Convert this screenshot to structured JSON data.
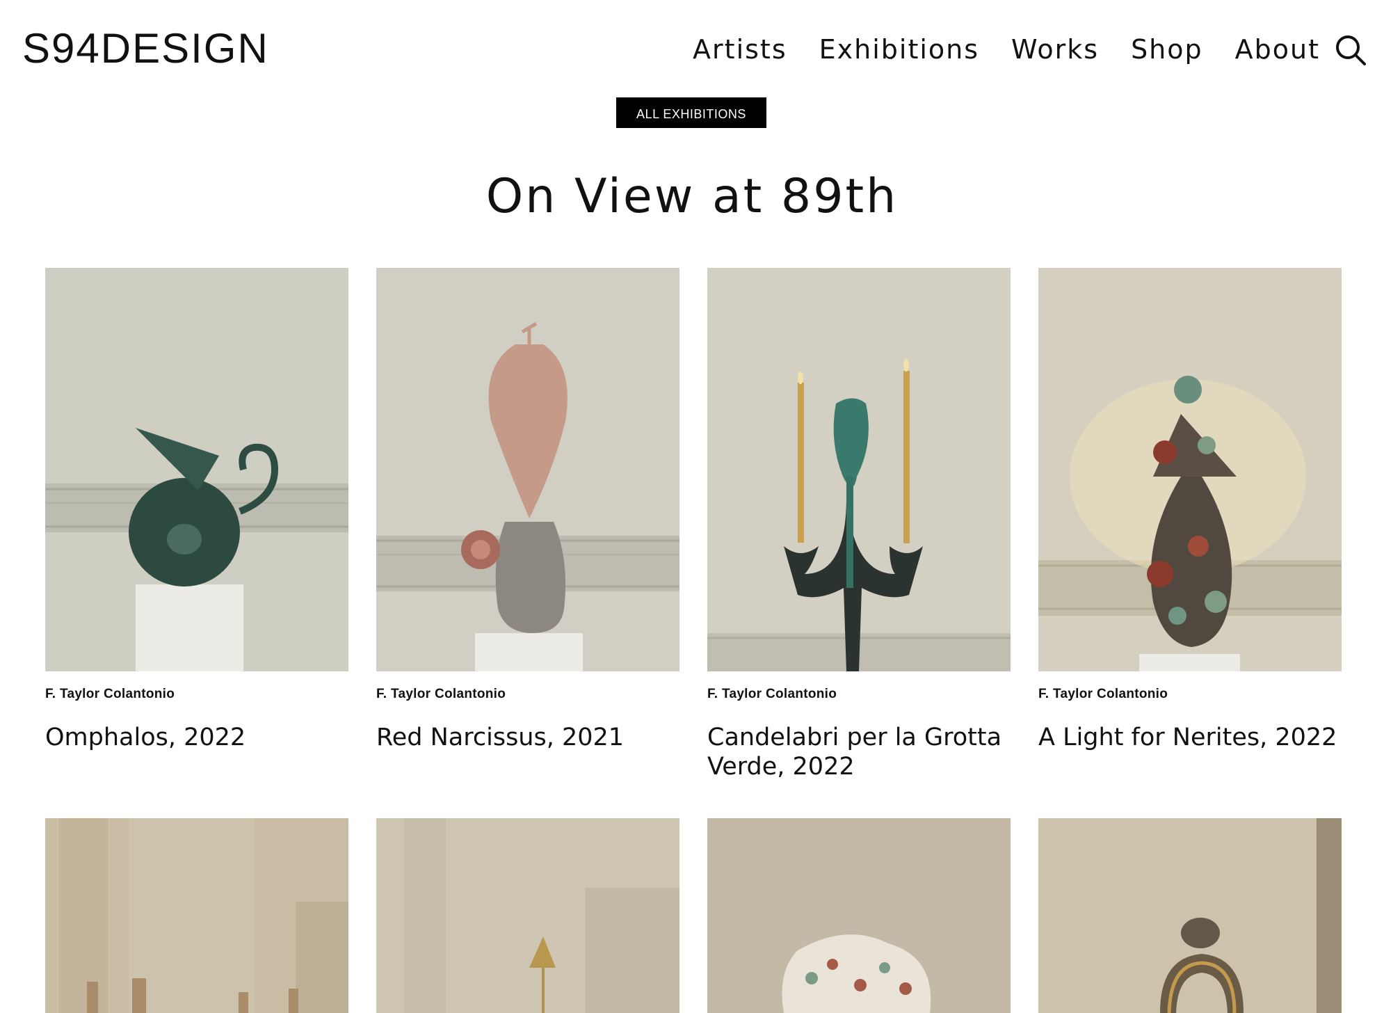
{
  "brand": {
    "logo": "S94DESIGN"
  },
  "nav": {
    "items": [
      {
        "label": "Artists"
      },
      {
        "label": "Exhibitions"
      },
      {
        "label": "Works"
      },
      {
        "label": "Shop"
      },
      {
        "label": "About"
      }
    ],
    "search_icon": "search-icon"
  },
  "button": {
    "all_exhibitions": "ALL EXHIBITIONS"
  },
  "section": {
    "title": "On View at 89th"
  },
  "works": [
    {
      "artist": "F. Taylor Colantonio",
      "title": "Omphalos, 2022"
    },
    {
      "artist": "F. Taylor Colantonio",
      "title": "Red Narcissus, 2021"
    },
    {
      "artist": "F. Taylor Colantonio",
      "title": "Candelabri per la Grotta Verde, 2022"
    },
    {
      "artist": "F. Taylor Colantonio",
      "title": "A Light for Nerites, 2022"
    }
  ]
}
